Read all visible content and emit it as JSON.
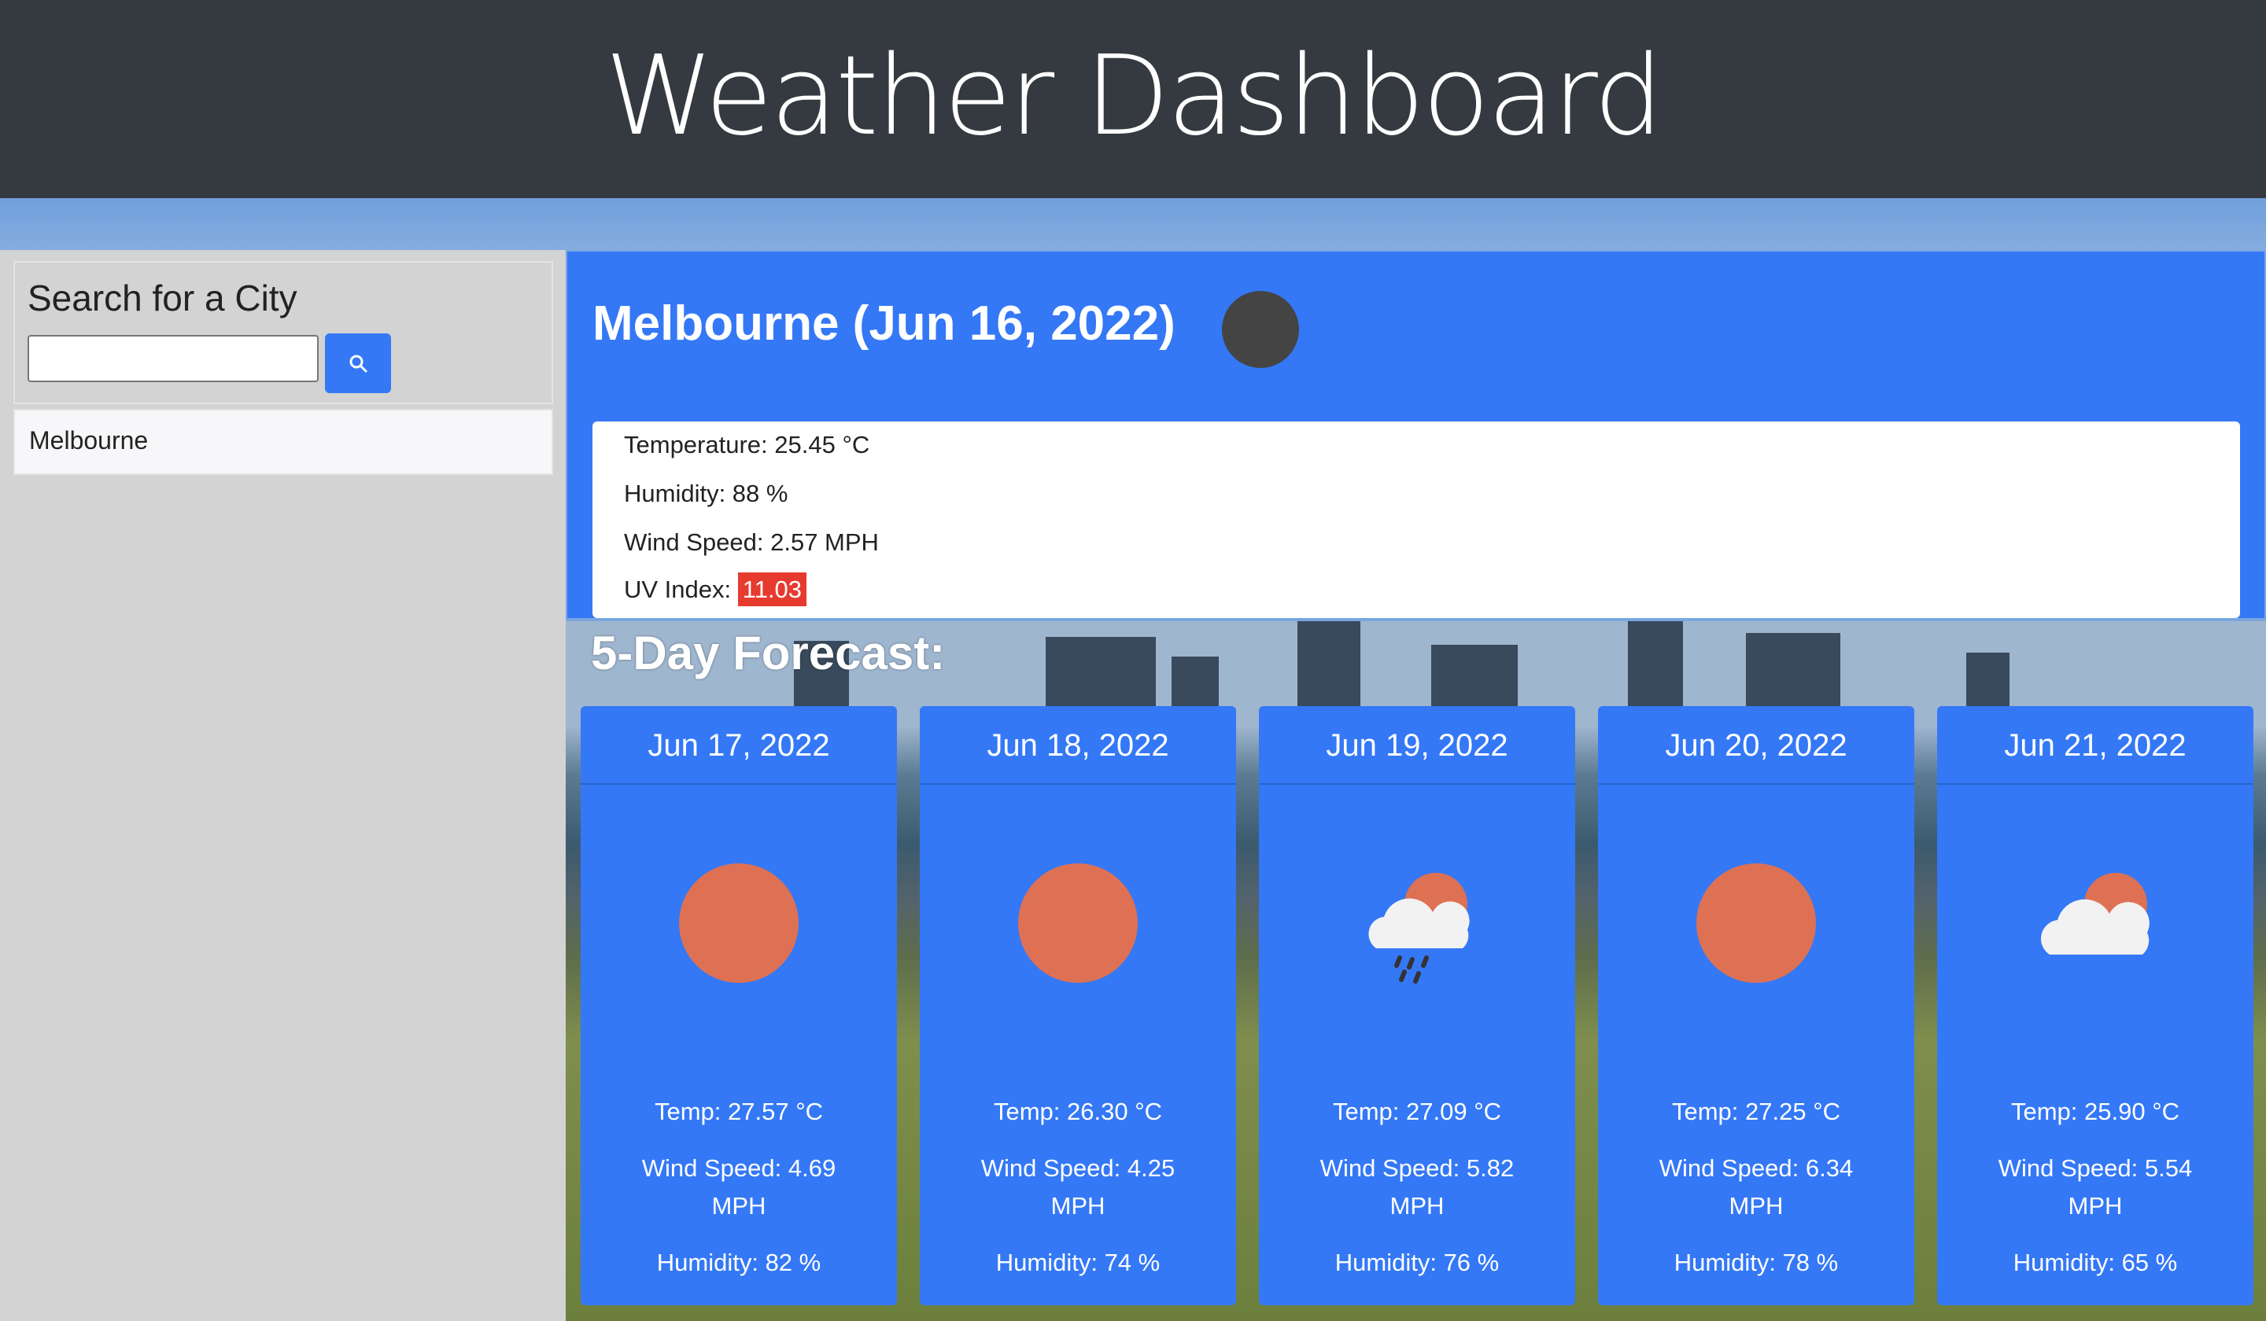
{
  "header": {
    "title": "Weather Dashboard"
  },
  "sidebar": {
    "search_title": "Search for a City",
    "search_value": "",
    "history": [
      "Melbourne"
    ]
  },
  "current": {
    "title": "Melbourne (Jun 16, 2022)",
    "icon": "dark-circle-icon",
    "temperature": "Temperature: 25.45 °C",
    "humidity": "Humidity: 88 %",
    "wind": "Wind Speed: 2.57 MPH",
    "uv_label": "UV Index:",
    "uv_value": "11.03"
  },
  "forecast": {
    "title": "5-Day Forecast:",
    "days": [
      {
        "date": "Jun 17, 2022",
        "icon": "sun-icon",
        "temp": "Temp: 27.57 °C",
        "wind1": "Wind Speed: 4.69",
        "wind2": "MPH",
        "humidity": "Humidity: 82 %"
      },
      {
        "date": "Jun 18, 2022",
        "icon": "sun-icon",
        "temp": "Temp: 26.30 °C",
        "wind1": "Wind Speed: 4.25",
        "wind2": "MPH",
        "humidity": "Humidity: 74 %"
      },
      {
        "date": "Jun 19, 2022",
        "icon": "rain-cloud-sun-icon",
        "temp": "Temp: 27.09 °C",
        "wind1": "Wind Speed: 5.82",
        "wind2": "MPH",
        "humidity": "Humidity: 76 %"
      },
      {
        "date": "Jun 20, 2022",
        "icon": "sun-icon",
        "temp": "Temp: 27.25 °C",
        "wind1": "Wind Speed: 6.34",
        "wind2": "MPH",
        "humidity": "Humidity: 78 %"
      },
      {
        "date": "Jun 21, 2022",
        "icon": "cloud-sun-icon",
        "temp": "Temp: 25.90 °C",
        "wind1": "Wind Speed: 5.54",
        "wind2": "MPH",
        "humidity": "Humidity: 65 %"
      }
    ]
  },
  "colors": {
    "header_bg": "#343a40",
    "accent": "#3478f6",
    "sun": "#de7153",
    "uv_danger": "#e73a2e"
  }
}
